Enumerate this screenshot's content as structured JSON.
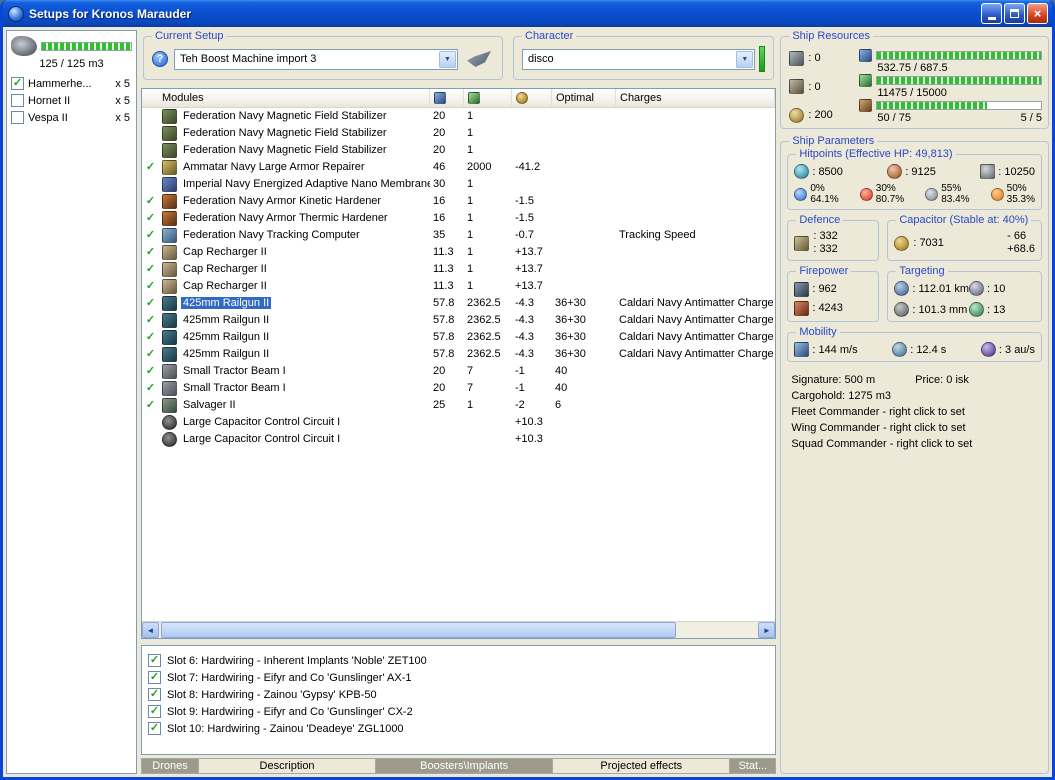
{
  "window": {
    "title": "Setups for Kronos Marauder"
  },
  "drone_bay": {
    "capacity": "125 / 125 m3",
    "items": [
      {
        "label": "Hammerhe...",
        "qty": "x 5",
        "checked": true
      },
      {
        "label": "Hornet II",
        "qty": "x 5",
        "checked": false
      },
      {
        "label": "Vespa II",
        "qty": "x 5",
        "checked": false
      }
    ]
  },
  "current_setup": {
    "label": "Current Setup",
    "value": "Teh Boost Machine import 3"
  },
  "character": {
    "label": "Character",
    "value": "disco"
  },
  "ship_resources": {
    "label": "Ship Resources",
    "hardpoints": [
      {
        "icon": "turret-hardpoint",
        "value": ": 0"
      },
      {
        "icon": "launcher-hardpoint",
        "value": ": 0"
      },
      {
        "icon": "calibration",
        "value": ": 200"
      }
    ],
    "bars": [
      {
        "icon": "cpu",
        "fill": 100,
        "text": "532.75 / 687.5",
        "extra": ""
      },
      {
        "icon": "powergrid",
        "fill": 100,
        "text": "11475 / 15000",
        "extra": ""
      },
      {
        "icon": "upgrade",
        "fill": 67,
        "text": "50 / 75",
        "extra": "5 / 5"
      }
    ]
  },
  "modules": {
    "title": "Modules",
    "optimal_header": "Optimal",
    "charges_header": "Charges",
    "rows": [
      {
        "check": false,
        "selected": false,
        "icon": "magstab",
        "name": "Federation Navy Magnetic Field Stabilizer",
        "cpu": "20",
        "pg": "1",
        "cap": "",
        "optimal": "",
        "charges": ""
      },
      {
        "check": false,
        "selected": false,
        "icon": "magstab",
        "name": "Federation Navy Magnetic Field Stabilizer",
        "cpu": "20",
        "pg": "1",
        "cap": "",
        "optimal": "",
        "charges": ""
      },
      {
        "check": false,
        "selected": false,
        "icon": "magstab",
        "name": "Federation Navy Magnetic Field Stabilizer",
        "cpu": "20",
        "pg": "1",
        "cap": "",
        "optimal": "",
        "charges": ""
      },
      {
        "check": true,
        "selected": false,
        "icon": "armor-repairer",
        "name": "Ammatar Navy Large Armor Repairer",
        "cpu": "46",
        "pg": "2000",
        "cap": "-41.2",
        "optimal": "",
        "charges": ""
      },
      {
        "check": false,
        "selected": false,
        "icon": "membrane",
        "name": "Imperial Navy Energized Adaptive Nano Membrane",
        "cpu": "30",
        "pg": "1",
        "cap": "",
        "optimal": "",
        "charges": ""
      },
      {
        "check": true,
        "selected": false,
        "icon": "armor-hardener",
        "name": "Federation Navy Armor Kinetic Hardener",
        "cpu": "16",
        "pg": "1",
        "cap": "-1.5",
        "optimal": "",
        "charges": ""
      },
      {
        "check": true,
        "selected": false,
        "icon": "armor-hardener",
        "name": "Federation Navy Armor Thermic Hardener",
        "cpu": "16",
        "pg": "1",
        "cap": "-1.5",
        "optimal": "",
        "charges": ""
      },
      {
        "check": true,
        "selected": false,
        "icon": "tracking-computer",
        "name": "Federation Navy Tracking Computer",
        "cpu": "35",
        "pg": "1",
        "cap": "-0.7",
        "optimal": "",
        "charges": "Tracking Speed"
      },
      {
        "check": true,
        "selected": false,
        "icon": "cap-recharger",
        "name": "Cap Recharger II",
        "cpu": "11.3",
        "pg": "1",
        "cap": "+13.7",
        "optimal": "",
        "charges": ""
      },
      {
        "check": true,
        "selected": false,
        "icon": "cap-recharger",
        "name": "Cap Recharger II",
        "cpu": "11.3",
        "pg": "1",
        "cap": "+13.7",
        "optimal": "",
        "charges": ""
      },
      {
        "check": true,
        "selected": false,
        "icon": "cap-recharger",
        "name": "Cap Recharger II",
        "cpu": "11.3",
        "pg": "1",
        "cap": "+13.7",
        "optimal": "",
        "charges": ""
      },
      {
        "check": true,
        "selected": true,
        "icon": "railgun",
        "name": "425mm Railgun II",
        "cpu": "57.8",
        "pg": "2362.5",
        "cap": "-4.3",
        "optimal": "36+30",
        "charges": "Caldari Navy Antimatter Charge L"
      },
      {
        "check": true,
        "selected": false,
        "icon": "railgun",
        "name": "425mm Railgun II",
        "cpu": "57.8",
        "pg": "2362.5",
        "cap": "-4.3",
        "optimal": "36+30",
        "charges": "Caldari Navy Antimatter Charge L"
      },
      {
        "check": true,
        "selected": false,
        "icon": "railgun",
        "name": "425mm Railgun II",
        "cpu": "57.8",
        "pg": "2362.5",
        "cap": "-4.3",
        "optimal": "36+30",
        "charges": "Caldari Navy Antimatter Charge L"
      },
      {
        "check": true,
        "selected": false,
        "icon": "railgun",
        "name": "425mm Railgun II",
        "cpu": "57.8",
        "pg": "2362.5",
        "cap": "-4.3",
        "optimal": "36+30",
        "charges": "Caldari Navy Antimatter Charge L"
      },
      {
        "check": true,
        "selected": false,
        "icon": "tractor-beam",
        "name": "Small Tractor Beam I",
        "cpu": "20",
        "pg": "7",
        "cap": "-1",
        "optimal": "40",
        "charges": ""
      },
      {
        "check": true,
        "selected": false,
        "icon": "tractor-beam",
        "name": "Small Tractor Beam I",
        "cpu": "20",
        "pg": "7",
        "cap": "-1",
        "optimal": "40",
        "charges": ""
      },
      {
        "check": true,
        "selected": false,
        "icon": "salvager",
        "name": "Salvager II",
        "cpu": "25",
        "pg": "1",
        "cap": "-2",
        "optimal": "6",
        "charges": ""
      },
      {
        "check": false,
        "selected": false,
        "icon": "rig",
        "name": "Large Capacitor Control Circuit I",
        "cpu": "",
        "pg": "",
        "cap": "+10.3",
        "optimal": "",
        "charges": ""
      },
      {
        "check": false,
        "selected": false,
        "icon": "rig",
        "name": "Large Capacitor Control Circuit I",
        "cpu": "",
        "pg": "",
        "cap": "+10.3",
        "optimal": "",
        "charges": ""
      }
    ]
  },
  "implants": {
    "items": [
      {
        "checked": true,
        "label": "Slot 6: Hardwiring - Inherent Implants 'Noble' ZET100"
      },
      {
        "checked": true,
        "label": "Slot 7: Hardwiring - Eifyr and Co 'Gunslinger' AX-1"
      },
      {
        "checked": true,
        "label": "Slot 8: Hardwiring - Zainou 'Gypsy' KPB-50"
      },
      {
        "checked": true,
        "label": "Slot 9: Hardwiring - Eifyr and Co 'Gunslinger' CX-2"
      },
      {
        "checked": true,
        "label": "Slot 10: Hardwiring - Zainou 'Deadeye' ZGL1000"
      }
    ]
  },
  "tabs": [
    {
      "label": "Drones",
      "active": true
    },
    {
      "label": "Description",
      "active": false
    },
    {
      "label": "Boosters\\Implants",
      "active": true
    },
    {
      "label": "Projected effects",
      "active": false
    },
    {
      "label": "Stat...",
      "active": true
    }
  ],
  "ship_parameters": {
    "label": "Ship Parameters",
    "hitpoints": {
      "label": "Hitpoints (Effective HP: 49,813)",
      "shield": ": 8500",
      "armor": ": 9125",
      "structure": ": 10250",
      "resists": [
        {
          "icon": "em-resist",
          "shield": "0%",
          "armor": "64.1%"
        },
        {
          "icon": "thermal-resist",
          "shield": "30%",
          "armor": "80.7%"
        },
        {
          "icon": "kinetic-resist",
          "shield": "55%",
          "armor": "83.4%"
        },
        {
          "icon": "explosive-resist",
          "shield": "50%",
          "armor": "35.3%"
        }
      ]
    },
    "defence": {
      "label": "Defence",
      "shield_value": ": 332",
      "armor_value": ": 332"
    },
    "capacitor": {
      "label": "Capacitor (Stable at: 40%)",
      "amount": ": 7031",
      "usage": "- 66",
      "peak": "+68.6"
    },
    "firepower": {
      "label": "Firepower",
      "dps": ": 962",
      "volley": ": 4243"
    },
    "targeting": {
      "label": "Targeting",
      "range": ": 112.01 km",
      "locked_targets": ": 10",
      "scan_resolution": ": 101.3 mm",
      "sensor_strength": ": 13"
    },
    "mobility": {
      "label": "Mobility",
      "max_velocity": ": 144 m/s",
      "align_time": ": 12.4 s",
      "warp_speed": ": 3 au/s"
    },
    "info": {
      "signature": "Signature: 500 m",
      "price": "Price: 0 isk",
      "cargohold": "Cargohold: 1275 m3",
      "fleet_commander": "Fleet Commander - right click to set",
      "wing_commander": "Wing Commander - right click to set",
      "squad_commander": "Squad Commander - right click to set"
    }
  }
}
